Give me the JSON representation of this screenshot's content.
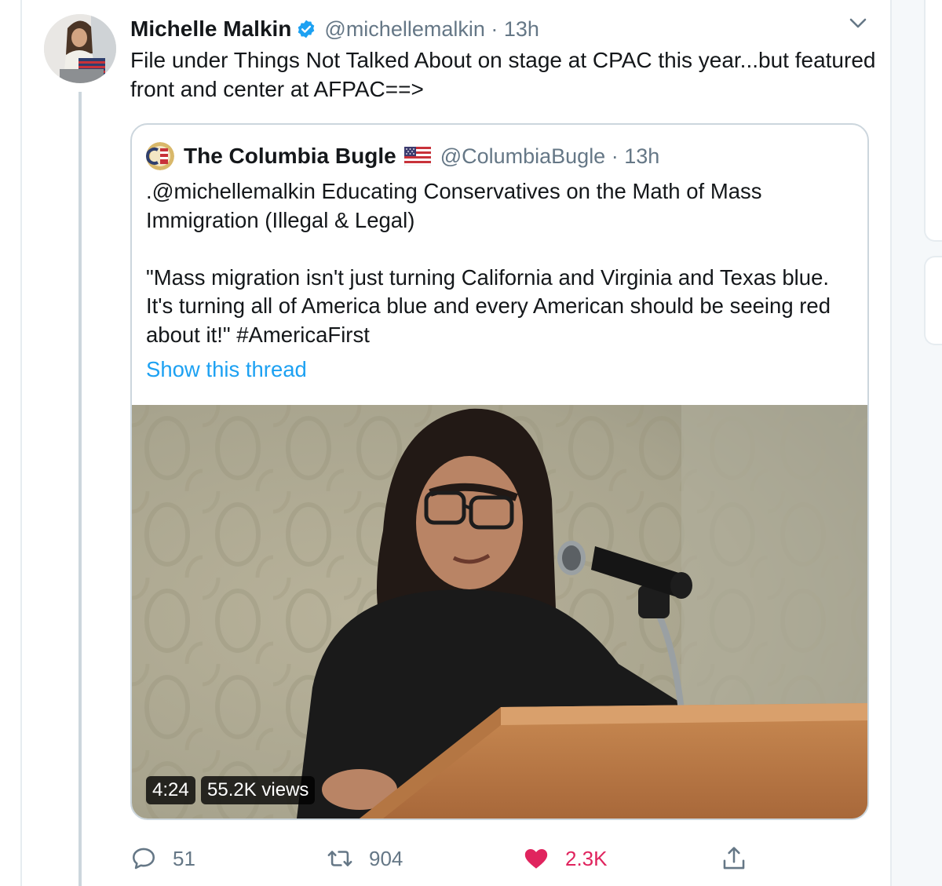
{
  "tweet": {
    "author_name": "Michelle Malkin",
    "handle": "@michellemalkin · 13h",
    "text": "File under Things Not Talked About on stage at CPAC this year...but featured front and center at AFPAC==>",
    "avatar_icon": "profile-photo",
    "verified_icon": "verified-badge-icon",
    "menu_icon": "chevron-down-icon"
  },
  "quoted": {
    "author_name": "The Columbia Bugle",
    "handle": "@ColumbiaBugle · 13h",
    "text": ".@michellemalkin Educating Conservatives on the Math of Mass\nImmigration (Illegal & Legal)\n\n\"Mass migration isn't just turning California and Virginia and Texas blue.\nIt's turning all of America blue and every American should be seeing red\nabout it!\" #AmericaFirst",
    "show_thread": "Show this thread",
    "video": {
      "duration": "4:24",
      "views": "55.2K views"
    }
  },
  "actions": {
    "replies": "51",
    "retweets": "904",
    "likes": "2.3K"
  },
  "colors": {
    "link": "#1da1f2",
    "like": "#e0245e",
    "muted": "#657786",
    "verified": "#1da1f2"
  }
}
